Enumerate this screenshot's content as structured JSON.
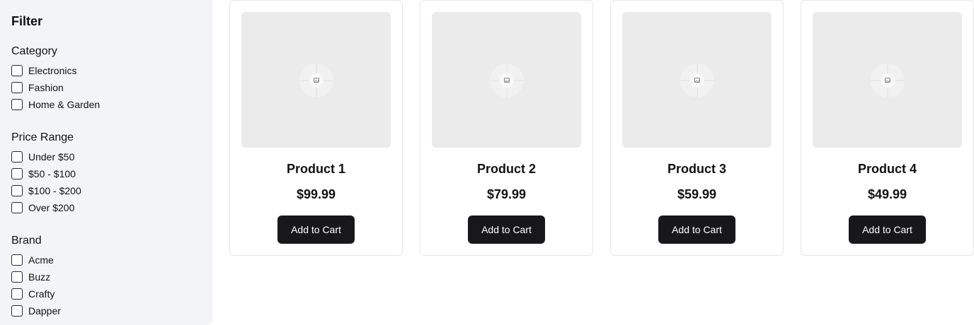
{
  "sidebar": {
    "title": "Filter",
    "sections": [
      {
        "title": "Category",
        "options": [
          "Electronics",
          "Fashion",
          "Home & Garden"
        ]
      },
      {
        "title": "Price Range",
        "options": [
          "Under $50",
          "$50 - $100",
          "$100 - $200",
          "Over $200"
        ]
      },
      {
        "title": "Brand",
        "options": [
          "Acme",
          "Buzz",
          "Crafty",
          "Dapper"
        ]
      }
    ]
  },
  "products": [
    {
      "name": "Product 1",
      "price": "$99.99",
      "button": "Add to Cart",
      "image_icon": "image-placeholder-icon"
    },
    {
      "name": "Product 2",
      "price": "$79.99",
      "button": "Add to Cart",
      "image_icon": "image-placeholder-icon"
    },
    {
      "name": "Product 3",
      "price": "$59.99",
      "button": "Add to Cart",
      "image_icon": "image-placeholder-icon"
    },
    {
      "name": "Product 4",
      "price": "$49.99",
      "button": "Add to Cart",
      "image_icon": "image-placeholder-icon"
    }
  ],
  "colors": {
    "sidebar_bg": "#f3f4f6",
    "button_bg": "#18181b",
    "placeholder_bg": "#ebebeb",
    "card_border": "#e5e7eb"
  }
}
